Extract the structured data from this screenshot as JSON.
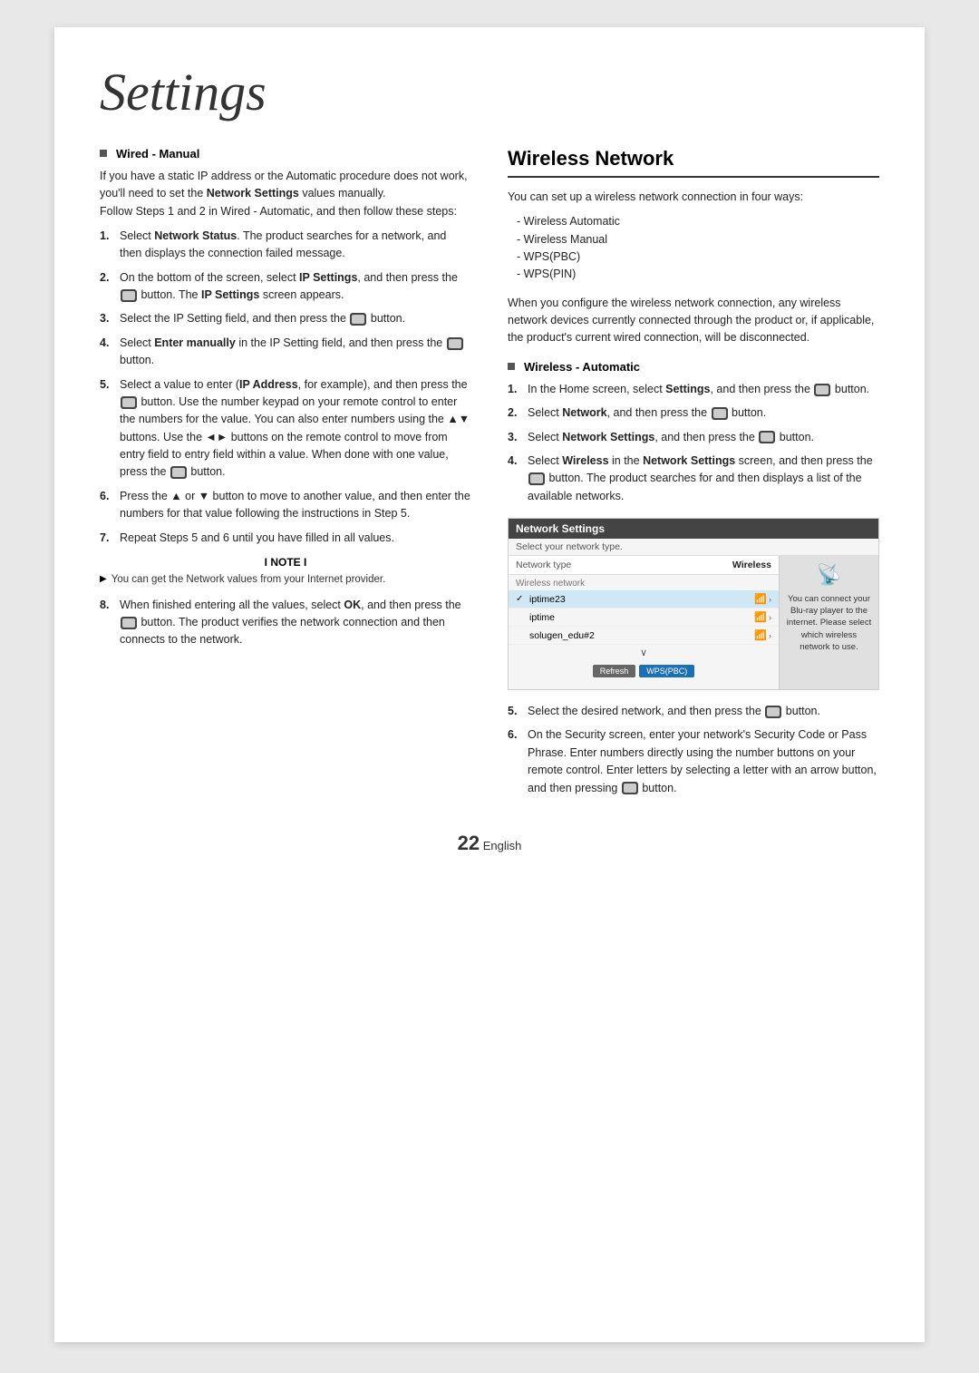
{
  "page": {
    "title": "Settings",
    "page_number": "22",
    "language": "English"
  },
  "left": {
    "section_heading": "Wired - Manual",
    "intro": "If you have a static IP address or the Automatic procedure does not work, you'll need to set the",
    "intro_bold": "Network Settings",
    "intro2": "values manually.",
    "intro3": "Follow Steps 1 and 2 in Wired - Automatic, and then follow these steps:",
    "steps": [
      {
        "text_before": "Select ",
        "bold": "Network Status",
        "text_after": ". The product searches for a network, and then displays the connection failed message."
      },
      {
        "text_before": "On the bottom of the screen, select ",
        "bold": "IP Settings",
        "text_after": ", and then press the",
        "has_btn": true,
        "text_after2": " button. The ",
        "bold2": "IP Settings",
        "text_after3": " screen appears."
      },
      {
        "text_before": "Select the IP Setting field, and then press the",
        "has_btn": true,
        "text_after": " button."
      },
      {
        "text_before": "Select ",
        "bold": "Enter manually",
        "text_after": " in the IP Setting field, and then press the",
        "has_btn": true,
        "text_after2": " button."
      },
      {
        "text_before": "Select a value to enter (",
        "bold": "IP Address",
        "text_after": ", for example), and then press the",
        "has_btn": true,
        "text_after2": " button. Use the number keypad on your remote control to enter the numbers for the value. You can also enter numbers using the ▲▼ buttons. Use the ◄► buttons on the remote control to move from entry field to entry field within a value. When done with one value, press the",
        "has_btn2": true,
        "text_after3": " button."
      },
      {
        "text_before": "Press the ▲ or ▼ button to move to another value, and then enter the numbers for that value following the instructions in Step 5."
      },
      {
        "text_before": "Repeat Steps 5 and 6 until you have filled in all values."
      }
    ],
    "note_label": "I NOTE I",
    "note_items": [
      "You can get the Network values from your Internet provider.",
      "When finished entering all the values, select OK, and then press the"
    ],
    "note_item2_bold": "OK",
    "note_item2_after": "button. The product verifies the network connection and then connects to the network."
  },
  "right": {
    "section_heading": "Wireless Network",
    "intro": "You can set up a wireless network connection in four ways:",
    "list_items": [
      "Wireless Automatic",
      "Wireless Manual",
      "WPS(PBC)",
      "WPS(PIN)"
    ],
    "body_text": "When you configure the wireless network connection, any wireless network devices currently connected through the product or, if applicable, the product's current wired connection, will be disconnected.",
    "subsection_heading": "Wireless - Automatic",
    "steps": [
      {
        "text_before": "In the Home screen, select ",
        "bold": "Settings",
        "text_after": ", and then press the",
        "has_btn": true,
        "text_after2": " button."
      },
      {
        "text_before": "Select ",
        "bold": "Network",
        "text_after": ", and then press the",
        "has_btn": true,
        "text_after2": " button."
      },
      {
        "text_before": "Select ",
        "bold": "Network Settings",
        "text_after": ", and then press the",
        "has_btn": true,
        "text_after2": " button."
      },
      {
        "text_before": "Select ",
        "bold": "Wireless",
        "text_after": " in the ",
        "bold2": "Network Settings",
        "text_after2": " screen, and then press the",
        "has_btn": true,
        "text_after3": " button. The product searches for and then displays a list of the available networks."
      }
    ],
    "network_box": {
      "header": "Network Settings",
      "subheader": "Select your network type.",
      "type_label": "Network type",
      "type_value": "Wireless",
      "wireless_label": "Wireless network",
      "networks": [
        {
          "name": "✓iptime23",
          "selected": true,
          "icon": "📶"
        },
        {
          "name": "iptime",
          "selected": false,
          "icon": "📶"
        },
        {
          "name": "solugen_edu#2",
          "selected": false,
          "icon": "📶"
        }
      ],
      "buttons": [
        "Refresh",
        "WPS(PBC)"
      ],
      "side_text": "You can connect your Blu-ray player to the internet. Please select which wireless network to use."
    },
    "steps_after": [
      {
        "num": "5",
        "text_before": "Select the desired network, and then press the",
        "has_btn": true,
        "text_after": " button."
      },
      {
        "num": "6",
        "text_before": "On the Security screen, enter your network's Security Code or Pass Phrase. Enter numbers directly using the number buttons on your remote control. Enter letters by selecting a letter with an arrow button, and then pressing",
        "has_btn": true,
        "text_after": " button."
      }
    ]
  },
  "icons": {
    "button": "🔲",
    "bullet": "▶",
    "check": "✓",
    "wifi": "≋"
  }
}
